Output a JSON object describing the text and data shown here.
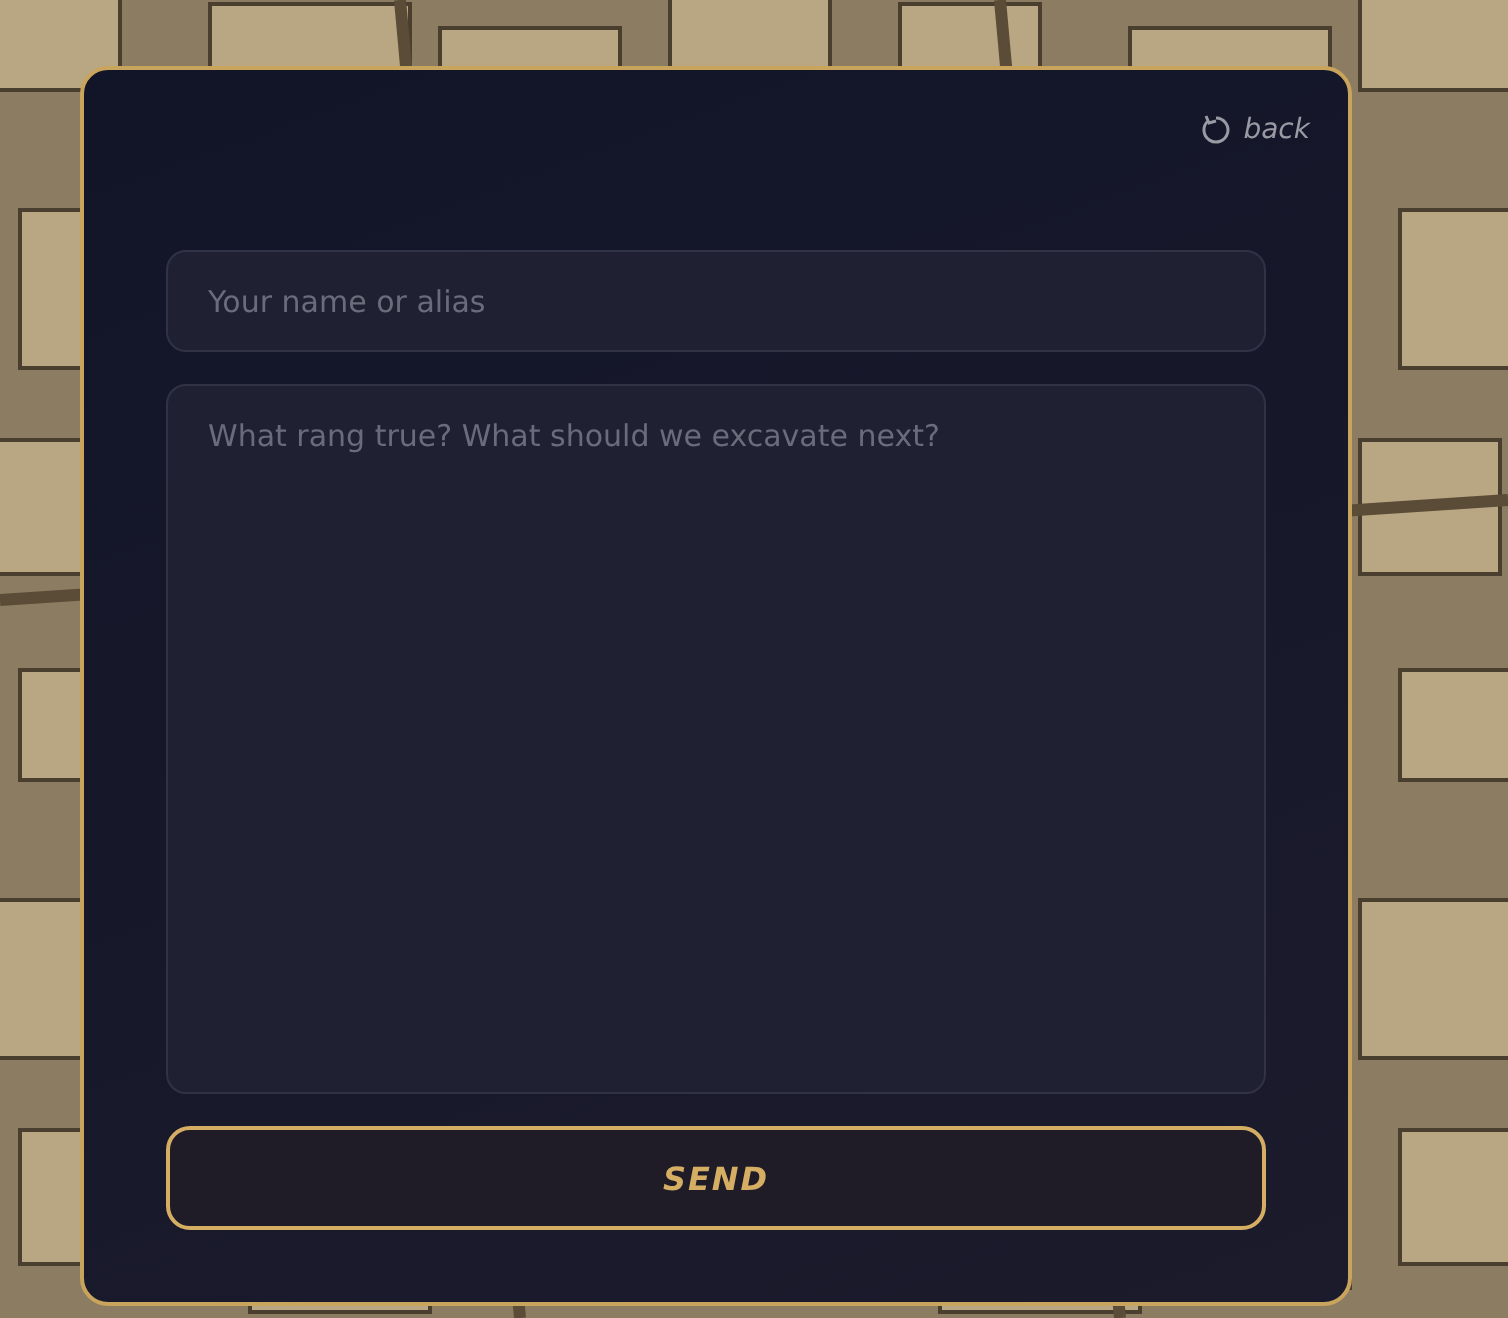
{
  "back_link": {
    "label": "back"
  },
  "name_field": {
    "placeholder": "Your name or alias"
  },
  "message_field": {
    "placeholder": "What rang true? What should we excavate next?"
  },
  "send_button": {
    "label": "SEND"
  }
}
